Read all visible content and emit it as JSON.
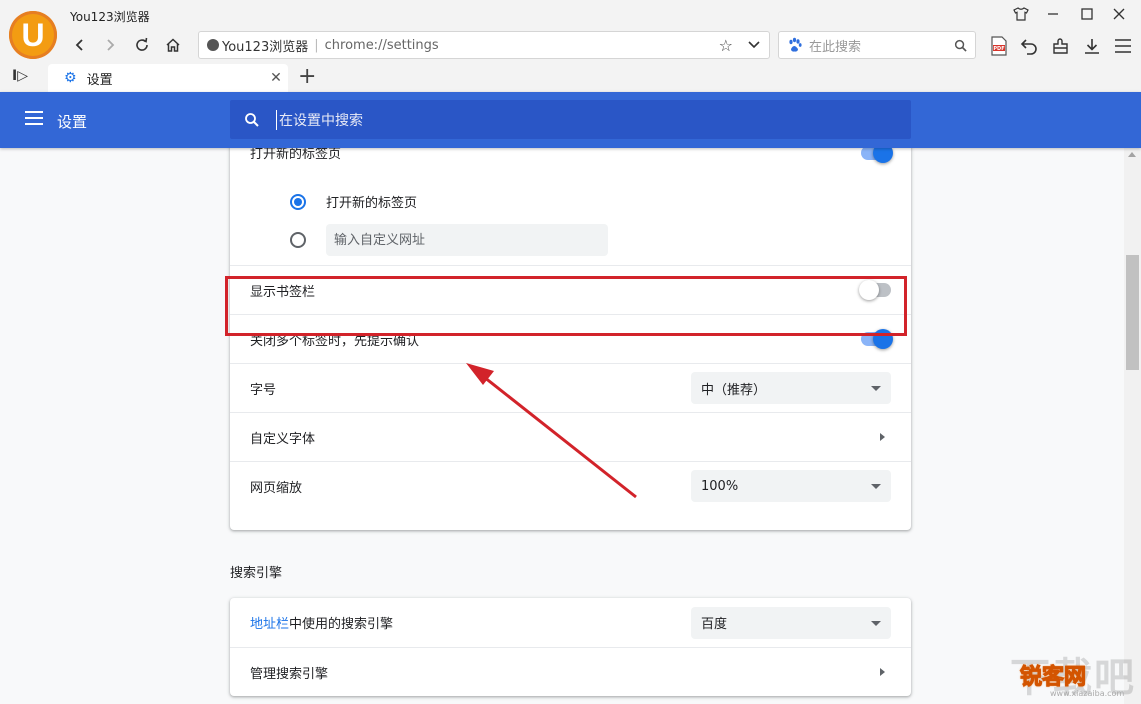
{
  "window": {
    "app_title": "You123浏览器",
    "logo_letter": "U",
    "controls": [
      "skin-icon",
      "minimize-icon",
      "maximize-icon",
      "close-icon"
    ]
  },
  "address_bar": {
    "site_name": "You123浏览器",
    "separator": "|",
    "url": "chrome://settings"
  },
  "search_box": {
    "placeholder": "在此搜索"
  },
  "tabs": [
    {
      "label": "设置",
      "icon": "gear-icon"
    }
  ],
  "settings_header": {
    "title": "设置",
    "search_placeholder": "在设置中搜索"
  },
  "startup": {
    "partial_label": "打开新的标签页",
    "options": [
      {
        "label": "打开新的标签页",
        "checked": true
      },
      {
        "label": "",
        "checked": false,
        "input_placeholder": "输入自定义网址"
      }
    ]
  },
  "appearance_rows": [
    {
      "label": "显示书签栏",
      "control": "toggle",
      "on": false
    },
    {
      "label": "关闭多个标签时，先提示确认",
      "control": "toggle",
      "on": true
    },
    {
      "label": "字号",
      "control": "select",
      "value": "中（推荐）"
    },
    {
      "label": "自定义字体",
      "control": "arrow"
    },
    {
      "label": "网页缩放",
      "control": "select",
      "value": "100%"
    }
  ],
  "search_engine": {
    "section_title": "搜索引擎",
    "rows": [
      {
        "label_link": "地址栏",
        "label_rest": "中使用的搜索引擎",
        "control": "select",
        "value": "百度"
      },
      {
        "label": "管理搜索引擎",
        "control": "arrow"
      }
    ]
  },
  "annotation": {
    "highlight_color": "#d2232a"
  },
  "watermark": {
    "top_text": "下载吧",
    "main_text": "锐客网",
    "small_text": "www.xiazaiba.com"
  },
  "colors": {
    "header_blue": "#3367d6",
    "accent": "#1a73e8",
    "logo_orange": "#f39c12"
  }
}
